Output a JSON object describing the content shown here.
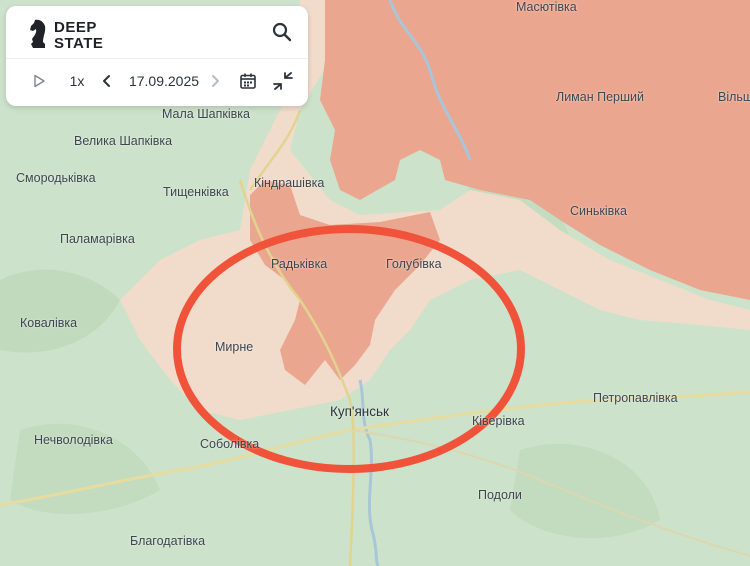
{
  "app": {
    "logo_line1": "DEEP",
    "logo_line2": "STATE",
    "search_icon": "search-icon"
  },
  "timeline": {
    "speed": "1x",
    "date": "17.09.2025",
    "icons": [
      "play-icon",
      "chevron-left-icon",
      "chevron-right-icon",
      "calendar-icon",
      "collapse-icon"
    ]
  },
  "colors": {
    "occupied": "#eaa58f",
    "contested": "#f1d9c9",
    "ukraine_controlled": "#c9e0c7",
    "highlight_circle": "#f0533a"
  },
  "map": {
    "places": [
      {
        "name": "Масютівка"
      },
      {
        "name": "Лиман Перший"
      },
      {
        "name": "Вільш"
      },
      {
        "name": "Мала Шапківка"
      },
      {
        "name": "Велика Шапківка"
      },
      {
        "name": "Смородьківка"
      },
      {
        "name": "Тищенківка"
      },
      {
        "name": "Кіндрашівка"
      },
      {
        "name": "Синьківка"
      },
      {
        "name": "Паламарівка"
      },
      {
        "name": "Радьківка"
      },
      {
        "name": "Голубівка"
      },
      {
        "name": "Ковалівка"
      },
      {
        "name": "Мирне"
      },
      {
        "name": "Петропавлівка"
      },
      {
        "name": "Куп'янськ"
      },
      {
        "name": "Ківерівка"
      },
      {
        "name": "Нечволодівка"
      },
      {
        "name": "Соболівка"
      },
      {
        "name": "Подоли"
      },
      {
        "name": "Благодатівка"
      }
    ]
  }
}
